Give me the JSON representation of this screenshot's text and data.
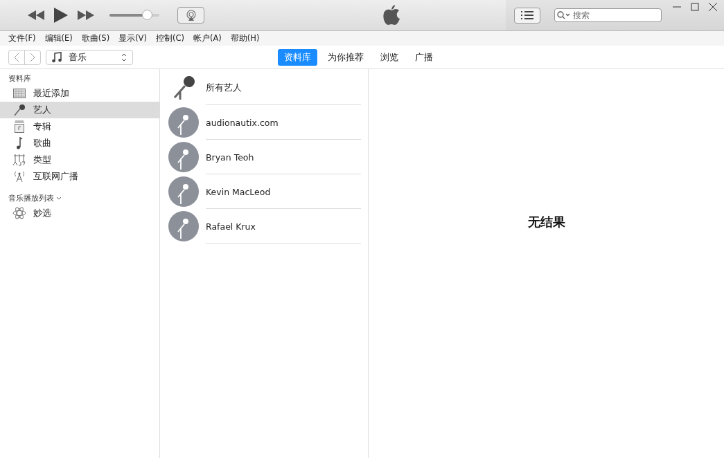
{
  "player": {
    "volume": {
      "level": 0.75
    }
  },
  "search": {
    "placeholder": "搜索"
  },
  "menu": [
    "文件(F)",
    "编辑(E)",
    "歌曲(S)",
    "显示(V)",
    "控制(C)",
    "帐户(A)",
    "帮助(H)"
  ],
  "media_picker": {
    "value": "音乐"
  },
  "tabs": [
    {
      "label": "资料库",
      "selected": true
    },
    {
      "label": "为你推荐",
      "selected": false
    },
    {
      "label": "浏览",
      "selected": false
    },
    {
      "label": "广播",
      "selected": false
    }
  ],
  "sidebar": {
    "library_heading": "资料库",
    "items": [
      {
        "label": "最近添加",
        "kind": "recent",
        "selected": false
      },
      {
        "label": "艺人",
        "kind": "artist",
        "selected": true
      },
      {
        "label": "专辑",
        "kind": "album",
        "selected": false
      },
      {
        "label": "歌曲",
        "kind": "song",
        "selected": false
      },
      {
        "label": "类型",
        "kind": "genre",
        "selected": false
      },
      {
        "label": "互联网广播",
        "kind": "radio",
        "selected": false
      }
    ],
    "playlists_heading": "音乐播放列表",
    "playlists": [
      {
        "label": "妙选",
        "kind": "genius",
        "selected": false
      }
    ]
  },
  "artists": [
    {
      "name": "所有艺人",
      "kind": "all"
    },
    {
      "name": "audionautix.com",
      "kind": "artist"
    },
    {
      "name": "Bryan Teoh",
      "kind": "artist"
    },
    {
      "name": "Kevin MacLeod",
      "kind": "artist"
    },
    {
      "name": "Rafael Krux",
      "kind": "artist"
    }
  ],
  "detail": {
    "message": "无结果"
  }
}
